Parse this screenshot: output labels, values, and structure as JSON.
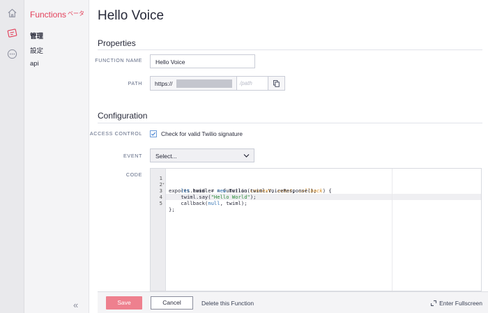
{
  "sidebar": {
    "title": "Functions",
    "beta": "ベータ",
    "items": [
      {
        "label": "管理",
        "selected": true
      },
      {
        "label": "設定",
        "selected": false
      },
      {
        "label": "api",
        "selected": false
      }
    ],
    "collapse": "«"
  },
  "page": {
    "title": "Hello Voice"
  },
  "properties": {
    "section_title": "Properties",
    "name_label": "FUNCTION NAME",
    "name_value": "Hello Voice",
    "path_label": "PATH",
    "path_prefix": "https://",
    "path_placeholder": "/path"
  },
  "configuration": {
    "section_title": "Configuration",
    "access_label": "ACCESS CONTROL",
    "access_checkbox_label": "Check for valid Twilio signature",
    "access_checked": true,
    "event_label": "EVENT",
    "event_value": "Select...",
    "code_label": "CODE"
  },
  "code_lines": [
    {
      "n": "1",
      "fold": true
    },
    {
      "n": "2",
      "fold": false
    },
    {
      "n": "3",
      "fold": false
    },
    {
      "n": "4",
      "fold": false
    },
    {
      "n": "5",
      "fold": false
    }
  ],
  "code": {
    "l1a": "exports.handler = function(",
    "l1p1": "context",
    "l1s1": ", ",
    "l1p2": "event",
    "l1s2": ", ",
    "l1p3": "callback",
    "l1b": ") {",
    "l2kw": "let",
    "l2a": " twiml = ",
    "l2kw2": "new",
    "l2b": " Twilio.twiml.VoiceResponse();",
    "l3a": "twiml.say(",
    "l3s": "\"Hello World\"",
    "l3b": ");",
    "l4a": "callback(",
    "l4kw": "null",
    "l4b": ", twiml);",
    "l5": "};"
  },
  "footer": {
    "save": "Save",
    "cancel": "Cancel",
    "delete": "Delete this Function",
    "fullscreen": "Enter Fullscreen"
  },
  "colors": {
    "brand_red": "#e3405a",
    "save_button": "#ee808e",
    "checkbox": "#6a9ad8"
  },
  "icons": [
    "home-icon",
    "functions-icon",
    "more-icon",
    "copy-icon",
    "chevron-down-icon",
    "check-icon",
    "expand-icon",
    "collapse-icon"
  ]
}
